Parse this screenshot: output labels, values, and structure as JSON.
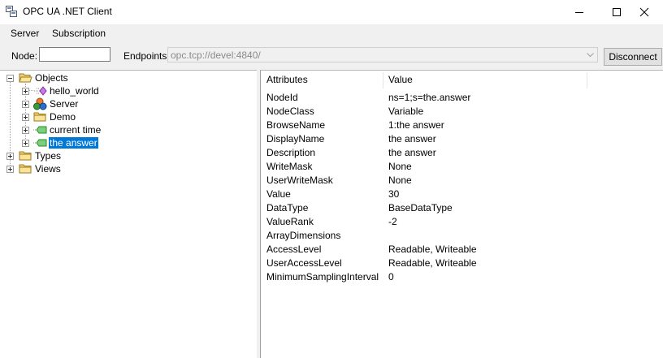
{
  "window": {
    "title": "OPC UA .NET Client"
  },
  "menu": [
    {
      "label": "Server"
    },
    {
      "label": "Subscription"
    }
  ],
  "toolbar": {
    "node_label": "Node:",
    "node_value": "",
    "endpoints_label": "Endpoints:",
    "endpoint_value": "opc.tcp://devel:4840/",
    "disconnect_label": "Disconnect"
  },
  "tree": {
    "root": "Objects",
    "children": [
      {
        "label": "hello_world",
        "icon": "method-icon"
      },
      {
        "label": "Server",
        "icon": "server-object-icon"
      },
      {
        "label": "Demo",
        "icon": "folder-icon"
      },
      {
        "label": "current time",
        "icon": "variable-icon"
      },
      {
        "label": "the answer",
        "icon": "variable-icon",
        "selected": true
      }
    ],
    "siblings": [
      {
        "label": "Types"
      },
      {
        "label": "Views"
      }
    ]
  },
  "attributes": {
    "headers": {
      "name": "Attributes",
      "value": "Value"
    },
    "rows": [
      {
        "name": "NodeId",
        "value": "ns=1;s=the.answer"
      },
      {
        "name": "NodeClass",
        "value": "Variable"
      },
      {
        "name": "BrowseName",
        "value": "1:the answer"
      },
      {
        "name": "DisplayName",
        "value": "the answer"
      },
      {
        "name": "Description",
        "value": "the answer"
      },
      {
        "name": "WriteMask",
        "value": "None"
      },
      {
        "name": "UserWriteMask",
        "value": "None"
      },
      {
        "name": "Value",
        "value": "30"
      },
      {
        "name": "DataType",
        "value": "BaseDataType"
      },
      {
        "name": "ValueRank",
        "value": "-2"
      },
      {
        "name": "ArrayDimensions",
        "value": ""
      },
      {
        "name": "AccessLevel",
        "value": "Readable, Writeable"
      },
      {
        "name": "UserAccessLevel",
        "value": "Readable, Writeable"
      },
      {
        "name": "MinimumSamplingInterval",
        "value": "0"
      }
    ]
  }
}
